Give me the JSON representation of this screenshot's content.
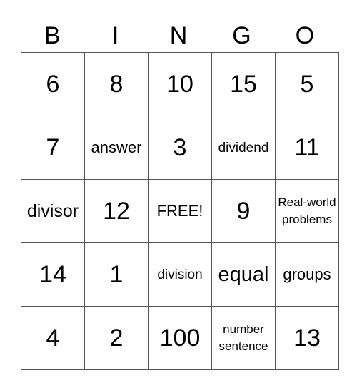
{
  "header": {
    "letters": [
      "B",
      "I",
      "N",
      "G",
      "O"
    ]
  },
  "rows": [
    [
      "6",
      "8",
      "10",
      "15",
      "5"
    ],
    [
      "7",
      "answer",
      "3",
      "dividend",
      "11"
    ],
    [
      "divisor",
      "12",
      "FREE!",
      "9",
      "Real-world problems"
    ],
    [
      "14",
      "1",
      "division",
      "equal",
      "groups"
    ],
    [
      "4",
      "2",
      "100",
      "number sentence",
      "13"
    ]
  ]
}
